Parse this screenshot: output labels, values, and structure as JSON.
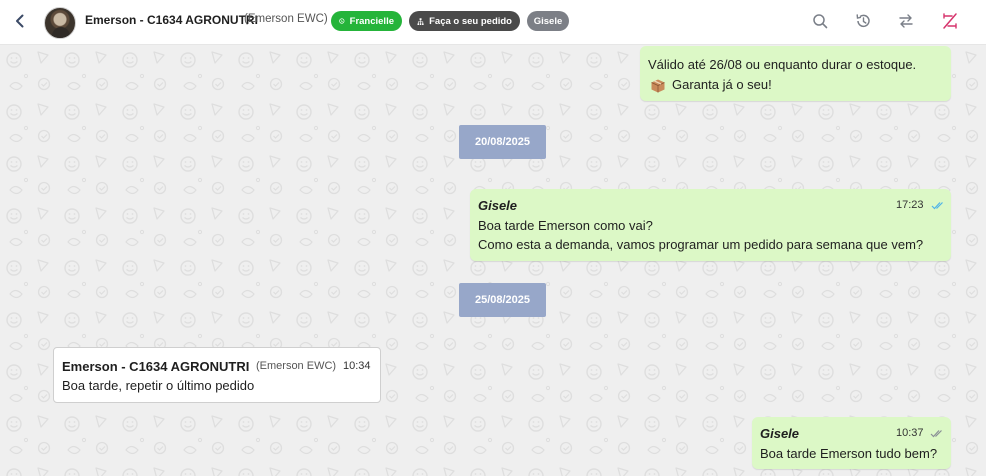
{
  "header": {
    "contact_name": "Emerson - C1634 AGRONUTRI",
    "contact_sub": "(Emerson EWC)",
    "chips": [
      {
        "label": "Francielle",
        "color": "#25b43a"
      },
      {
        "label": "Faça o seu pedido",
        "color": "#4a4a4a"
      },
      {
        "label": "Gisele",
        "color": "#7c7f86"
      }
    ],
    "icons": [
      "search-icon",
      "history-icon",
      "transfer-icon",
      "close-ticket-icon"
    ]
  },
  "messages": [
    {
      "direction": "out",
      "lines": [
        "Válido até 26/08 ou enquanto durar o estoque.",
        "Garanta já o seu!"
      ],
      "emoji": "package-icon"
    },
    {
      "type": "date",
      "label": "20/08/2025"
    },
    {
      "direction": "out",
      "sender": "Gisele",
      "time": "17:23",
      "lines": [
        "Boa tarde Emerson como vai?",
        "Como esta a demanda, vamos programar um pedido para semana que vem?"
      ],
      "status": "read"
    },
    {
      "type": "date",
      "label": "25/08/2025"
    },
    {
      "direction": "in",
      "sender": "Emerson - C1634 AGRONUTRI",
      "sender_sub": "(Emerson EWC)",
      "time": "10:34",
      "lines": [
        "Boa tarde, repetir o último pedido"
      ]
    },
    {
      "direction": "out",
      "sender": "Gisele",
      "time": "10:37",
      "lines": [
        "Boa tarde Emerson tudo bem?"
      ],
      "status": "delivered"
    }
  ],
  "colors": {
    "bubble_out": "#dcf8c6",
    "bubble_in": "#ffffff",
    "date_pill": "#97a7c9",
    "read_tick": "#4fb3e8",
    "accent_close": "#d6336c"
  }
}
